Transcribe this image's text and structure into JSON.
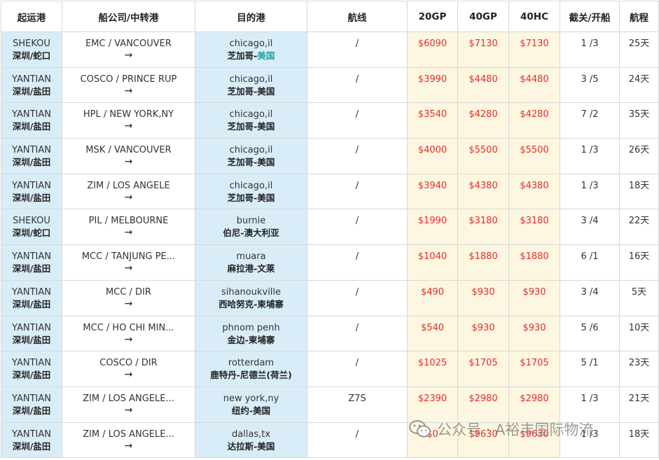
{
  "headers": [
    "起运港",
    "船公司/中转港",
    "目的港",
    "航线",
    "20GP",
    "40GP",
    "40HC",
    "截关/开船",
    "航程"
  ],
  "rows": [
    {
      "origin_en": "SHEKOU",
      "origin_cn": "深圳/蛇口",
      "carrier": "EMC / VANCOUVER",
      "arrow": "→",
      "dest_en": "chicago,il",
      "dest_cn_a": "芝加哥-",
      "dest_cn_b": "美国",
      "route": "/",
      "p20gp": "$6090",
      "p40gp": "$7130",
      "p40hc": "$7130",
      "schedule": "1 /3",
      "transit": "25天"
    },
    {
      "origin_en": "YANTIAN",
      "origin_cn": "深圳/盐田",
      "carrier": "COSCO / PRINCE RUP",
      "arrow": "→",
      "dest_en": "chicago,il",
      "dest_cn_a": "芝加哥-美国",
      "dest_cn_b": "",
      "route": "/",
      "p20gp": "$3990",
      "p40gp": "$4480",
      "p40hc": "$4480",
      "schedule": "3 /5",
      "transit": "24天"
    },
    {
      "origin_en": "YANTIAN",
      "origin_cn": "深圳/盐田",
      "carrier": "HPL / NEW YORK,NY",
      "arrow": "→",
      "dest_en": "chicago,il",
      "dest_cn_a": "芝加哥-美国",
      "dest_cn_b": "",
      "route": "/",
      "p20gp": "$3540",
      "p40gp": "$4280",
      "p40hc": "$4280",
      "schedule": "7 /2",
      "transit": "35天"
    },
    {
      "origin_en": "YANTIAN",
      "origin_cn": "深圳/盐田",
      "carrier": "MSK / VANCOUVER",
      "arrow": "→",
      "dest_en": "chicago,il",
      "dest_cn_a": "芝加哥-美国",
      "dest_cn_b": "",
      "route": "/",
      "p20gp": "$4000",
      "p40gp": "$5500",
      "p40hc": "$5500",
      "schedule": "1 /3",
      "transit": "26天"
    },
    {
      "origin_en": "YANTIAN",
      "origin_cn": "深圳/盐田",
      "carrier": "ZIM / LOS ANGELE",
      "arrow": "→",
      "dest_en": "chicago,il",
      "dest_cn_a": "芝加哥-美国",
      "dest_cn_b": "",
      "route": "/",
      "p20gp": "$3940",
      "p40gp": "$4380",
      "p40hc": "$4380",
      "schedule": "1 /3",
      "transit": "18天"
    },
    {
      "origin_en": "SHEKOU",
      "origin_cn": "深圳/蛇口",
      "carrier": "PIL / MELBOURNE",
      "arrow": "→",
      "dest_en": "burnie",
      "dest_cn_a": "伯尼-澳大利亚",
      "dest_cn_b": "",
      "route": "/",
      "p20gp": "$1990",
      "p40gp": "$3180",
      "p40hc": "$3180",
      "schedule": "3 /4",
      "transit": "22天"
    },
    {
      "origin_en": "YANTIAN",
      "origin_cn": "深圳/盐田",
      "carrier": "MCC / TANJUNG PE...",
      "arrow": "→",
      "dest_en": "muara",
      "dest_cn_a": "麻拉港-文莱",
      "dest_cn_b": "",
      "route": "/",
      "p20gp": "$1040",
      "p40gp": "$1880",
      "p40hc": "$1880",
      "schedule": "6 /1",
      "transit": "16天"
    },
    {
      "origin_en": "YANTIAN",
      "origin_cn": "深圳/盐田",
      "carrier": "MCC / DIR",
      "arrow": "→",
      "dest_en": "sihanoukville",
      "dest_cn_a": "西哈努克-柬埔寨",
      "dest_cn_b": "",
      "route": "/",
      "p20gp": "$490",
      "p40gp": "$930",
      "p40hc": "$930",
      "schedule": "3 /4",
      "transit": "5天"
    },
    {
      "origin_en": "YANTIAN",
      "origin_cn": "深圳/盐田",
      "carrier": "MCC / HO CHI MIN...",
      "arrow": "→",
      "dest_en": "phnom penh",
      "dest_cn_a": "金边-柬埔寨",
      "dest_cn_b": "",
      "route": "/",
      "p20gp": "$540",
      "p40gp": "$930",
      "p40hc": "$930",
      "schedule": "5 /6",
      "transit": "10天"
    },
    {
      "origin_en": "YANTIAN",
      "origin_cn": "深圳/盐田",
      "carrier": "COSCO / DIR",
      "arrow": "→",
      "dest_en": "rotterdam",
      "dest_cn_a": "鹿特丹-尼德兰(荷兰)",
      "dest_cn_b": "",
      "route": "/",
      "p20gp": "$1025",
      "p40gp": "$1705",
      "p40hc": "$1705",
      "schedule": "5 /1",
      "transit": "23天"
    },
    {
      "origin_en": "YANTIAN",
      "origin_cn": "深圳/盐田",
      "carrier": "ZIM / LOS ANGELE...",
      "arrow": "→",
      "dest_en": "new york,ny",
      "dest_cn_a": "纽约-美国",
      "dest_cn_b": "",
      "route": "Z7S",
      "p20gp": "$2390",
      "p40gp": "$2980",
      "p40hc": "$2980",
      "schedule": "1 /3",
      "transit": "21天"
    },
    {
      "origin_en": "YANTIAN",
      "origin_cn": "深圳/盐田",
      "carrier": "ZIM / LOS ANGELE...",
      "arrow": "→",
      "dest_en": "dallas,tx",
      "dest_cn_a": "达拉斯-美国",
      "dest_cn_b": "",
      "route": "/",
      "p20gp": "$0",
      "p40gp": "$9630",
      "p40hc": "$9630",
      "schedule": "1 /3",
      "transit": "18天"
    }
  ],
  "watermark": {
    "text": "公众号 · A裕丰国际物流",
    "icon": "wechat-icon"
  },
  "colors": {
    "price": "#e62b2b",
    "port_bg": "#d9edf8",
    "price_bg": "#fdf7e1",
    "accent": "#20a7a0"
  }
}
